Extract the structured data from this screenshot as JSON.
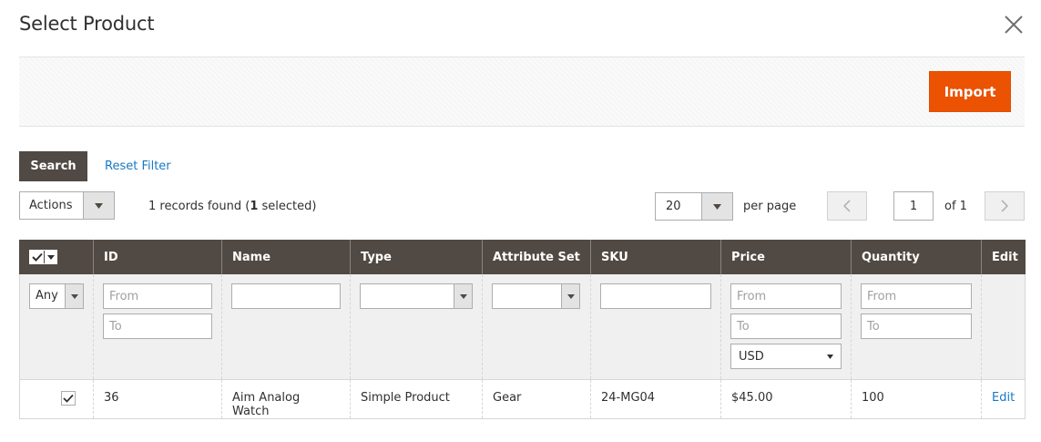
{
  "modal": {
    "title": "Select Product"
  },
  "toolbar": {
    "import_label": "Import"
  },
  "filters_bar": {
    "search_label": "Search",
    "reset_label": "Reset Filter"
  },
  "actions": {
    "selected": "Actions"
  },
  "records": {
    "count": "1",
    "text_prefix": " records found (",
    "selected_count": "1",
    "text_suffix": " selected)"
  },
  "pager": {
    "per_page_value": "20",
    "per_page_label": "per page",
    "current_page": "1",
    "of_label": "of 1"
  },
  "grid": {
    "columns": [
      "ID",
      "Name",
      "Type",
      "Attribute Set",
      "SKU",
      "Price",
      "Quantity",
      "Edit"
    ],
    "filters": {
      "checkbox_select": "Any",
      "from_placeholder": "From",
      "to_placeholder": "To",
      "currency": "USD"
    },
    "rows": [
      {
        "checked": true,
        "id": "36",
        "name": "Aim Analog Watch",
        "type": "Simple Product",
        "attribute_set": "Gear",
        "sku": "24-MG04",
        "price": "$45.00",
        "quantity": "100",
        "edit": "Edit"
      }
    ]
  },
  "colors": {
    "accent": "#eb5202",
    "header_bg": "#514943",
    "link": "#1979c3"
  }
}
